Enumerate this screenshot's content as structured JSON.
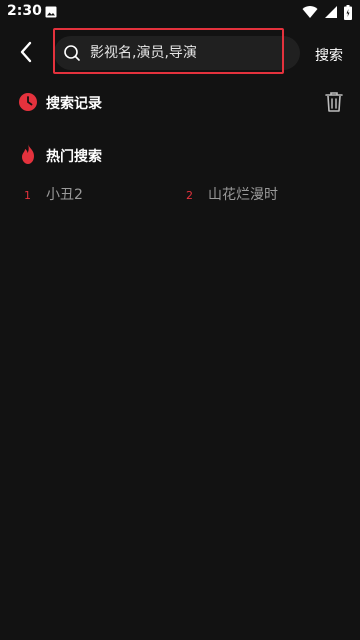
{
  "status_bar": {
    "time": "2:30"
  },
  "header": {
    "search_placeholder": "影视名,演员,导演",
    "search_action_label": "搜索"
  },
  "history": {
    "title": "搜索记录"
  },
  "hot": {
    "title": "热门搜索",
    "items": [
      {
        "rank": "1",
        "label": "小丑2"
      },
      {
        "rank": "2",
        "label": "山花烂漫时"
      }
    ]
  },
  "colors": {
    "background": "#121212",
    "accent": "#e4323d",
    "search_bg": "#202020"
  },
  "icons": {
    "back": "back-arrow-icon",
    "search": "search-icon",
    "history": "clock-icon",
    "trash": "trash-icon",
    "hot": "fire-icon"
  }
}
